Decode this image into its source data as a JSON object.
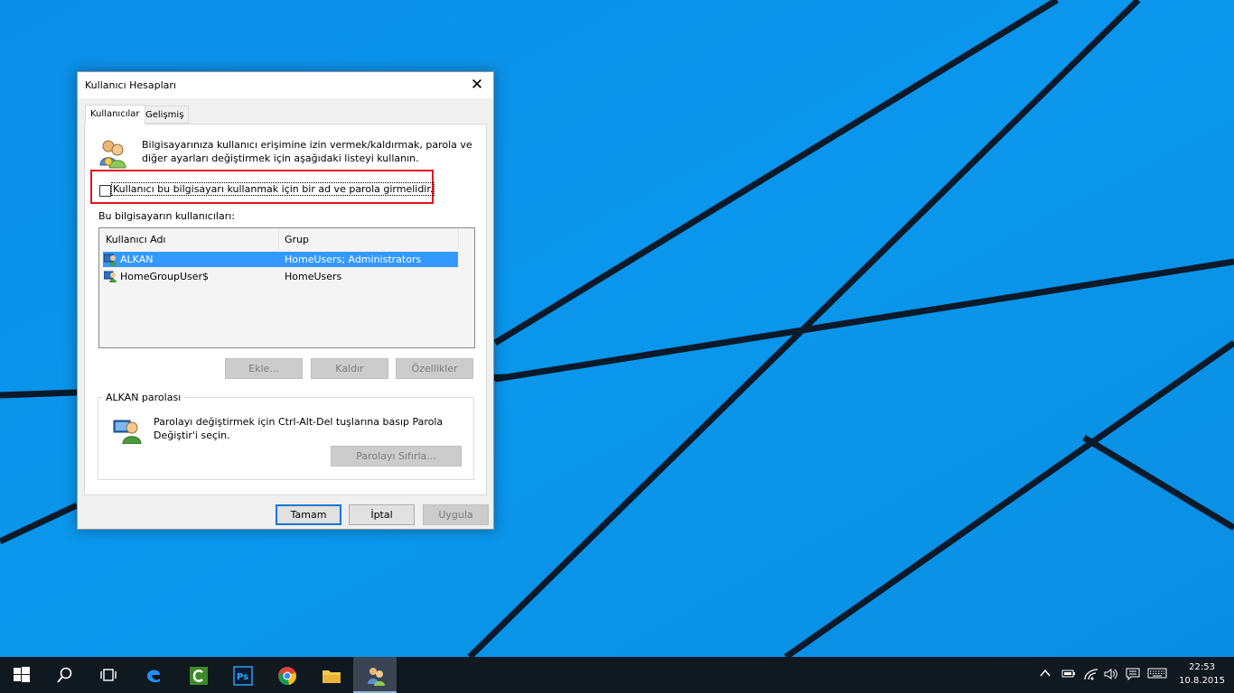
{
  "dialog": {
    "title": "Kullanıcı Hesapları",
    "tabs": [
      {
        "label": "Kullanıcılar",
        "active": true
      },
      {
        "label": "Gelişmiş",
        "active": false
      }
    ],
    "intro_line1": "Bilgisayarınıza kullanıcı erişimine izin vermek/kaldırmak, parola ve",
    "intro_line2": "diğer ayarları değiştirmek için aşağıdaki listeyi kullanın.",
    "require_password_label": "Kullanıcı bu bilgisayarı kullanmak için bir ad ve parola girmelidir.",
    "require_password_checked": false,
    "users_label": "Bu bilgisayarın kullanıcıları:",
    "columns": [
      "Kullanıcı Adı",
      "Grup"
    ],
    "users": [
      {
        "name": "ALKAN",
        "group": "HomeUsers; Administrators",
        "selected": true
      },
      {
        "name": "HomeGroupUser$",
        "group": "HomeUsers",
        "selected": false
      }
    ],
    "buttons": {
      "add": "Ekle...",
      "remove": "Kaldır",
      "properties": "Özellikler",
      "reset_password": "Parolayı Sıfırla...",
      "ok": "Tamam",
      "cancel": "İptal",
      "apply": "Uygula"
    },
    "password_group_title": "ALKAN parolası",
    "password_text_line1": "Parolayı değiştirmek için Ctrl-Alt-Del tuşlarına basıp Parola",
    "password_text_line2": "Değiştir'i seçin."
  },
  "taskbar": {
    "apps": [
      "start-icon",
      "search-icon",
      "task-view-icon",
      "edge-icon",
      "camtasia-icon",
      "photoshop-icon",
      "chrome-icon",
      "file-explorer-icon",
      "user-accounts-icon"
    ],
    "clock_time": "22:53",
    "clock_date": "10.8.2015"
  },
  "colors": {
    "desktop": "#0a8fe6",
    "taskbar": "#101820",
    "selection": "#3399ff",
    "highlight_box": "#e0141e"
  }
}
